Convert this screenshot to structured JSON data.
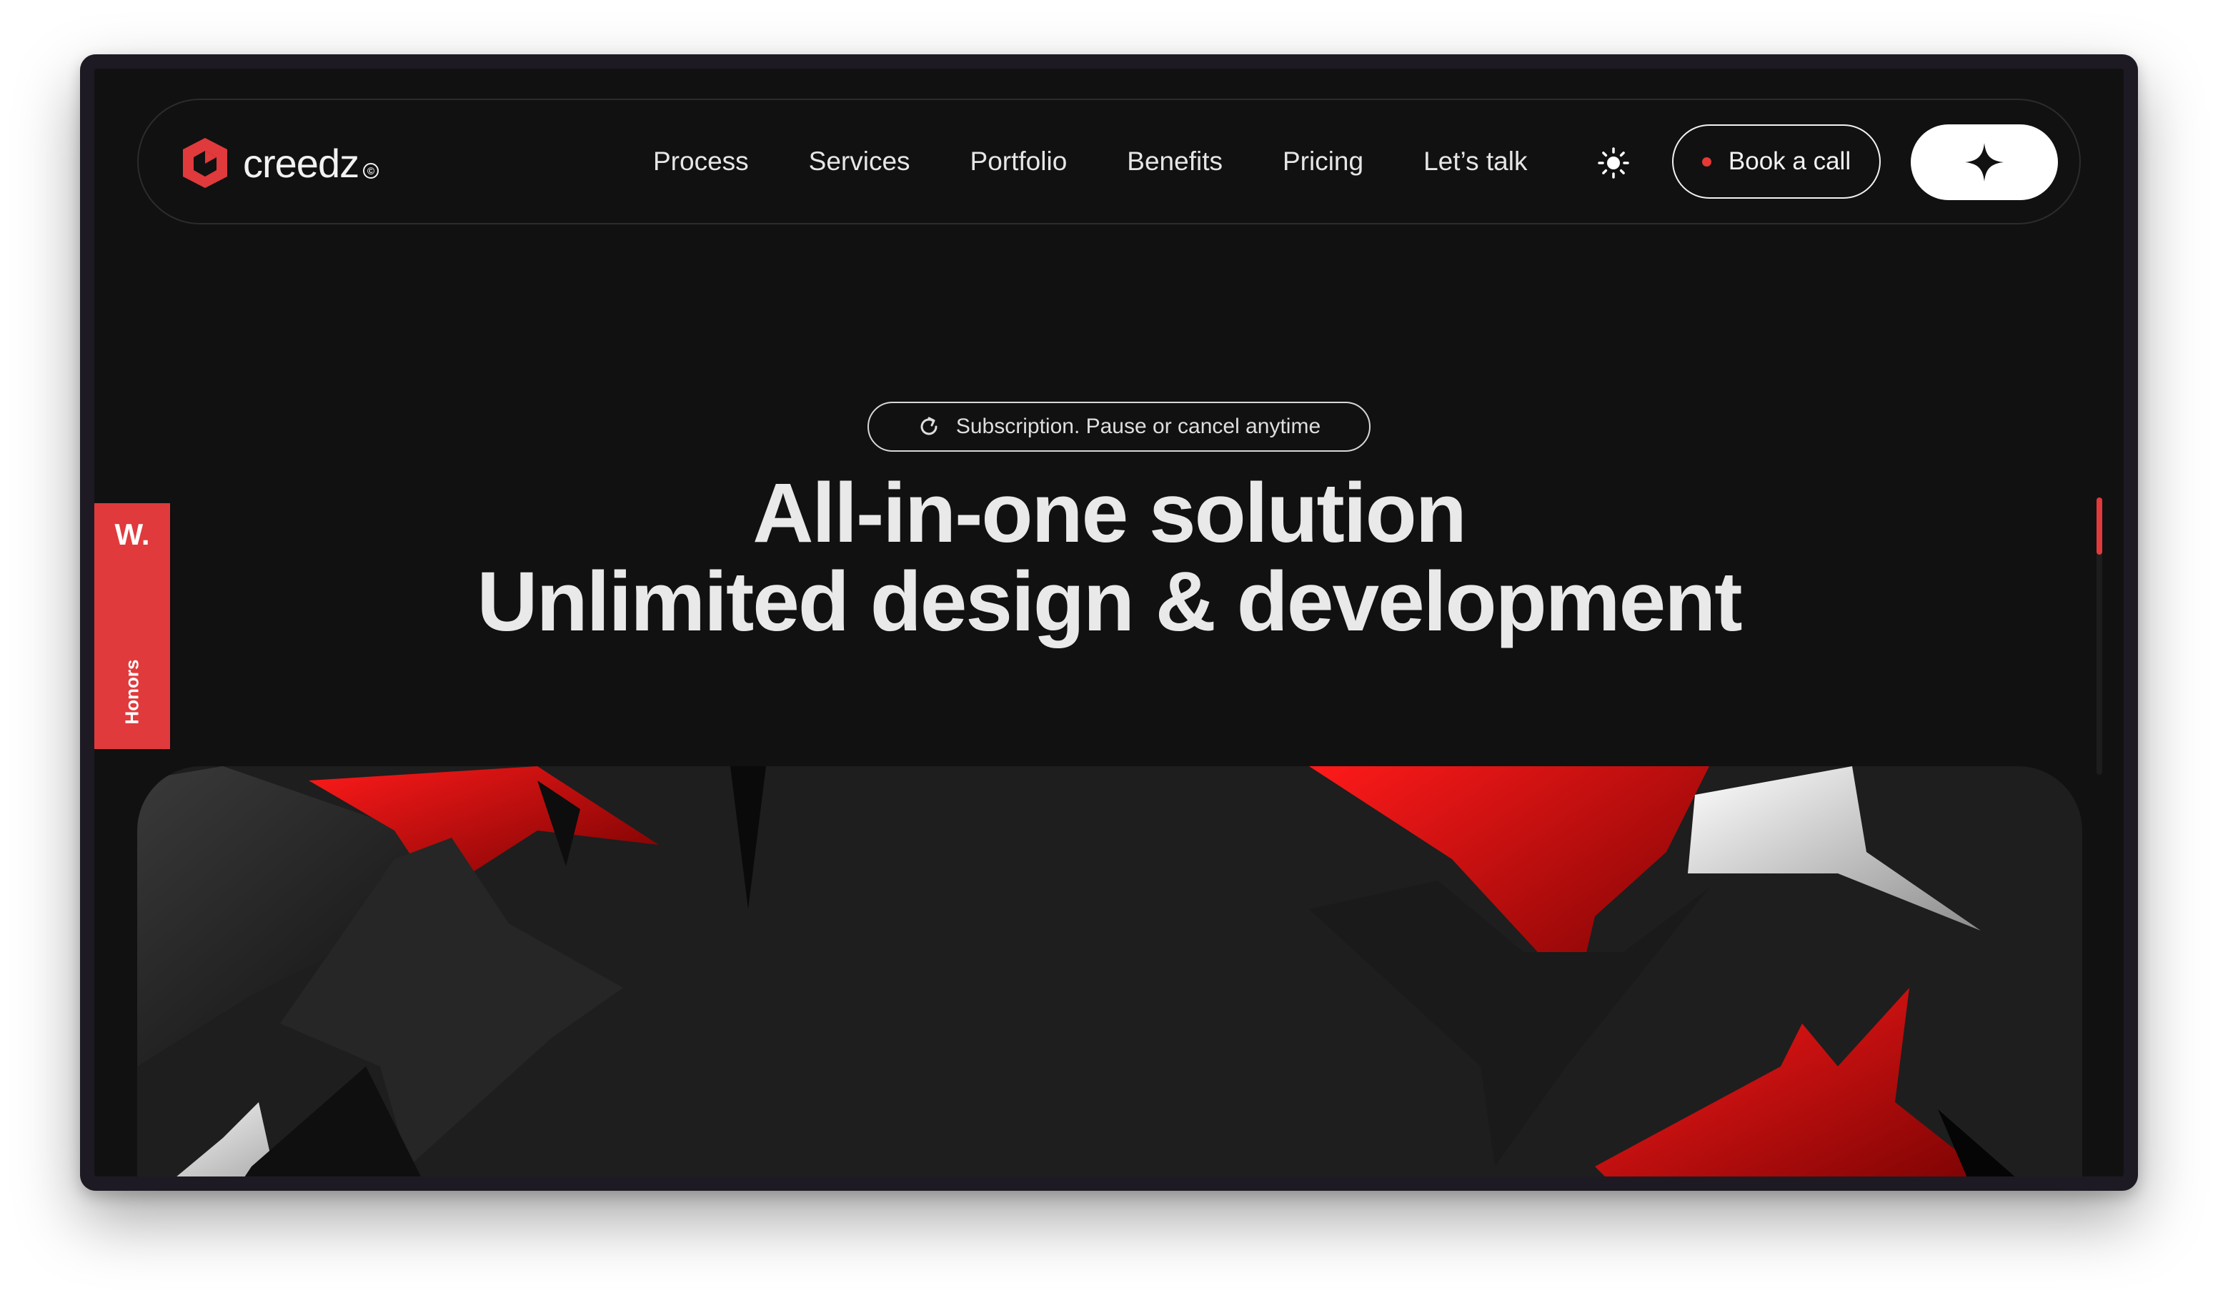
{
  "brand": {
    "name": "creedz",
    "mark": "©",
    "accent": "#e03a3c"
  },
  "nav": {
    "links": [
      "Process",
      "Services",
      "Portfolio",
      "Benefits",
      "Pricing",
      "Let’s talk"
    ],
    "theme_icon": "sun-icon",
    "book_call_label": "Book a call",
    "action_icon": "sparkle-icon"
  },
  "hero": {
    "badge_text": "Subscription. Pause or cancel anytime",
    "badge_icon": "refresh-icon",
    "headline_line1": "All-in-one solution",
    "headline_line2": "Unlimited design & development"
  },
  "side_tab": {
    "mark": "W.",
    "label": "Honors"
  },
  "colors": {
    "background": "#111111",
    "text": "#e9e9e9",
    "red": "#e03a3c"
  }
}
